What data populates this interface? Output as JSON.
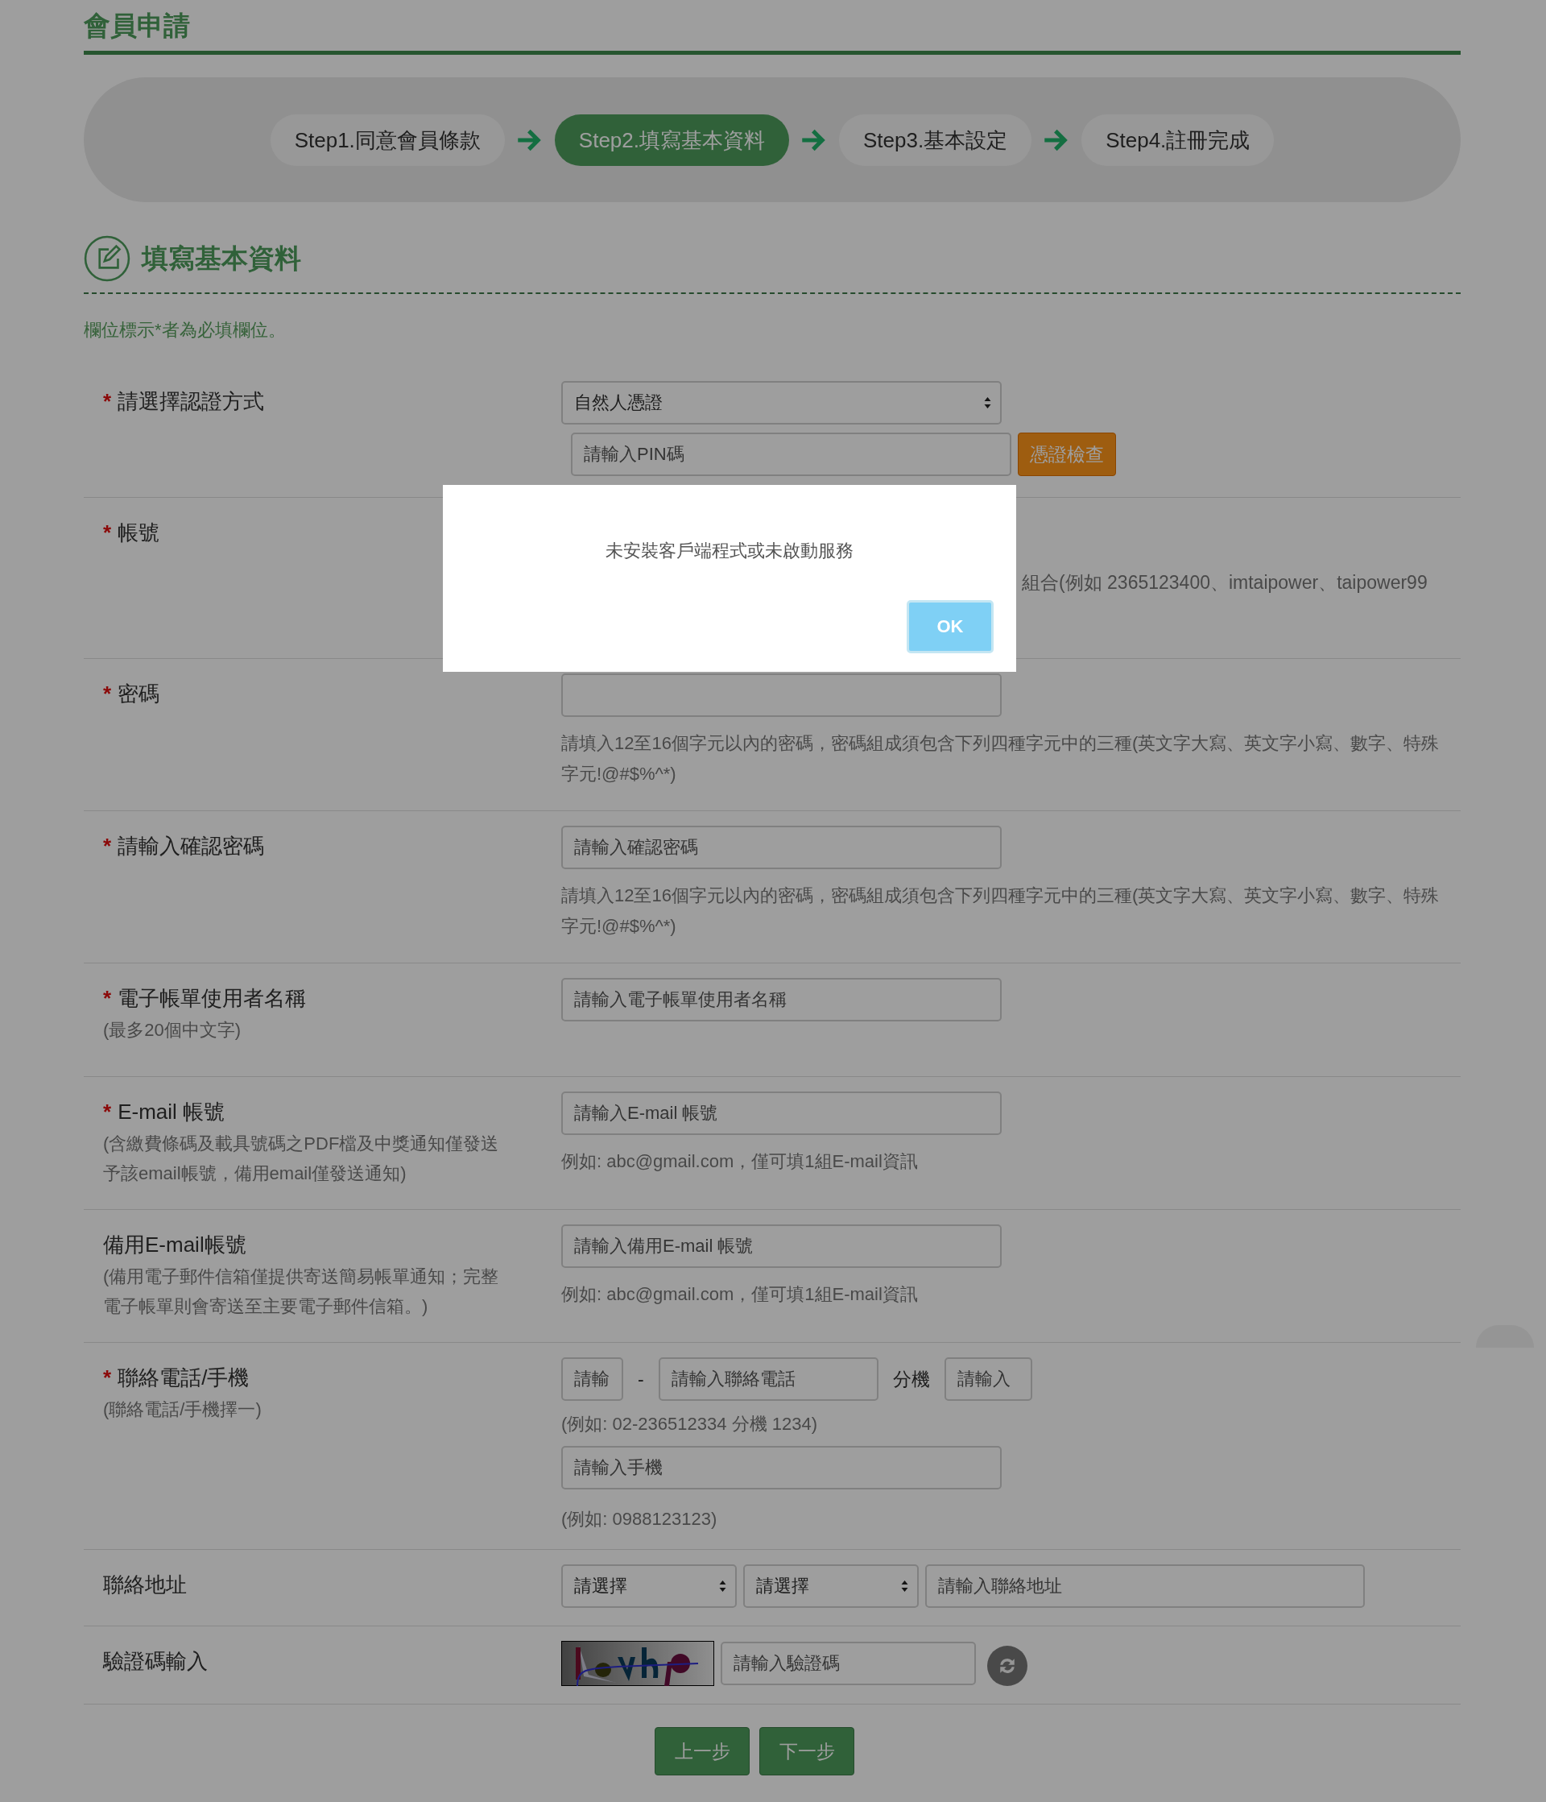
{
  "page_title": "會員申請",
  "steps": [
    {
      "label": "Step1.同意會員條款",
      "selected": false
    },
    {
      "label": "Step2.填寫基本資料",
      "selected": true
    },
    {
      "label": "Step3.基本設定",
      "selected": false
    },
    {
      "label": "Step4.註冊完成",
      "selected": false
    }
  ],
  "section": {
    "title": "填寫基本資料",
    "note": "欄位標示*者為必填欄位。"
  },
  "required_mark": "*",
  "rows": [
    {
      "kind": "auth",
      "required": true,
      "label": "請選擇認證方式",
      "select": "自然人憑證",
      "pin_placeholder": "請輸入PIN碼",
      "button": "憑證檢查"
    },
    {
      "kind": "hint_only",
      "required": true,
      "label": "帳號",
      "hint": "組合(例如 2365123400、imtaipower、taipower99"
    },
    {
      "kind": "input",
      "required": true,
      "label": "密碼",
      "hint": "請填入12至16個字元以內的密碼，密碼組成須包含下列四種字元中的三種(英文字大寫、英文字小寫、數字、特殊字元!@#$%^*)"
    },
    {
      "kind": "input",
      "required": true,
      "label": "請輸入確認密碼",
      "placeholder": "請輸入確認密碼",
      "hint": "請填入12至16個字元以內的密碼，密碼組成須包含下列四種字元中的三種(英文字大寫、英文字小寫、數字、特殊字元!@#$%^*)"
    },
    {
      "kind": "input",
      "required": true,
      "label": "電子帳單使用者名稱",
      "sublabel": "(最多20個中文字)",
      "placeholder": "請輸入電子帳單使用者名稱"
    },
    {
      "kind": "input",
      "required": true,
      "label": "E-mail 帳號",
      "sublabel": "(含繳費條碼及載具號碼之PDF檔及中獎通知僅發送予該email帳號，備用email僅發送通知)",
      "placeholder": "請輸入E-mail 帳號",
      "hint": "例如: abc@gmail.com，僅可填1組E-mail資訊"
    },
    {
      "kind": "input",
      "required": false,
      "label": "備用E-mail帳號",
      "sublabel": "(備用電子郵件信箱僅提供寄送簡易帳單通知；完整電子帳單則會寄送至主要電子郵件信箱。)",
      "placeholder": "請輸入備用E-mail 帳號",
      "hint": "例如: abc@gmail.com，僅可填1組E-mail資訊"
    },
    {
      "kind": "phone",
      "required": true,
      "label": "聯絡電話/手機",
      "sublabel": "(聯絡電話/手機擇一)",
      "area_placeholder": "請輸",
      "dash": "-",
      "phone_placeholder": "請輸入聯絡電話",
      "ext_label": "分機",
      "ext_placeholder": "請輸入",
      "phone_example": "(例如: 02-236512334 分機 1234)",
      "mobile_placeholder": "請輸入手機",
      "mobile_example": "(例如: 0988123123)"
    },
    {
      "kind": "address",
      "required": false,
      "label": "聯絡地址",
      "selects": [
        "請選擇",
        "請選擇"
      ],
      "placeholder": "請輸入聯絡地址"
    },
    {
      "kind": "captcha",
      "required": false,
      "label": "驗證碼輸入",
      "placeholder": "請輸入驗證碼"
    }
  ],
  "buttons": [
    "上一步",
    "下一步"
  ],
  "dialog": {
    "message": "未安裝客戶端程式或未啟動服務",
    "button": "OK"
  }
}
